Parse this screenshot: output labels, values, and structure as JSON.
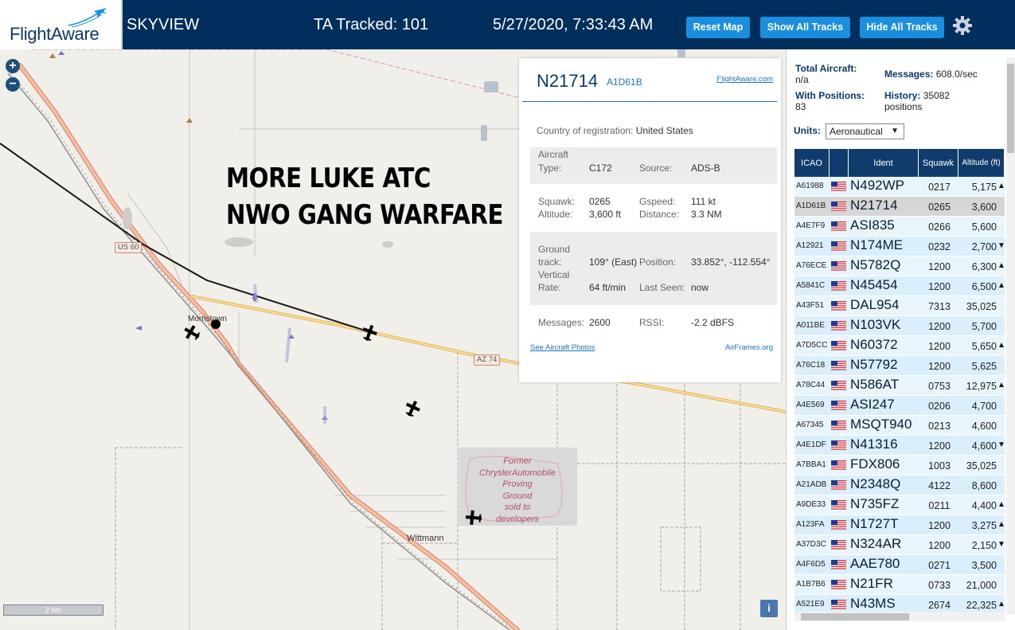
{
  "header": {
    "logo_text": "FlightAware",
    "site_name": "SKYVIEW",
    "tracked": "TA Tracked: 101",
    "datetime": "5/27/2020, 7:33:43 AM",
    "buttons": {
      "reset": "Reset Map",
      "show": "Show All Tracks",
      "hide": "Hide All Tracks"
    },
    "accent": "#1a8fe0",
    "bg": "#002f5d"
  },
  "map": {
    "zoom_in": "+",
    "zoom_out": "−",
    "caption_line1": "MORE LUKE ATC",
    "caption_line2": "NWO GANG WARFARE",
    "place_morristown": "Morristown",
    "place_wittmann": "Wittmann",
    "hwy_us60": "US 60",
    "hwy_az74": "AZ 74",
    "area_label": [
      "Former",
      "ChryslerAutomobile",
      "Proving",
      "Ground",
      "sold to",
      "developers"
    ],
    "scale": "2 nm",
    "info": "i"
  },
  "popup": {
    "ident": "N21714",
    "hex": "A1D61B",
    "link": "FlightAware.com",
    "country_label": "Country of registration:",
    "country": "United States",
    "aircraft_type_label_1": "Aircraft",
    "aircraft_type_label_2": "Type:",
    "aircraft_type": "C172",
    "source_label": "Source:",
    "source": "ADS-B",
    "squawk_label": "Squawk:",
    "squawk": "0265",
    "gspeed_label": "Gspeed:",
    "gspeed": "111 kt",
    "altitude_label": "Altitude:",
    "altitude": "3,600 ft",
    "distance_label": "Distance:",
    "distance": "3.3 NM",
    "track_label_1": "Ground",
    "track_label_2": "track:",
    "track": "109° (East)",
    "position_label": "Position:",
    "position": "33.852°, -112.554°",
    "vrate_label_1": "Vertical",
    "vrate_label_2": "Rate:",
    "vrate": "64 ft/min",
    "lastseen_label": "Last Seen:",
    "lastseen": "now",
    "messages_label": "Messages:",
    "messages": "2600",
    "rssi_label": "RSSI:",
    "rssi": "-2.2 dBFS",
    "photos_link": "See Aircraft Photos",
    "airframes_link": "AirFrames.org"
  },
  "panel": {
    "total_label": "Total Aircraft:",
    "total": "n/a",
    "messages_label": "Messages:",
    "messages": "608.0/sec",
    "positions_label": "With Positions:",
    "positions": "83",
    "history_label": "History:",
    "history": "35082 positions",
    "units_label": "Units:",
    "units_value": "Aeronautical",
    "columns": {
      "icao": "ICAO",
      "ident": "Ident",
      "squawk": "Squawk",
      "altitude": "Altitude (ft)"
    },
    "rows": [
      {
        "icao": "A61988",
        "ident": "N492WP",
        "squawk": "0217",
        "alt": "5,175",
        "trend": "▲"
      },
      {
        "icao": "A1D61B",
        "ident": "N21714",
        "squawk": "0265",
        "alt": "3,600",
        "trend": ""
      },
      {
        "icao": "A4E7F9",
        "ident": "ASI835",
        "squawk": "0266",
        "alt": "5,600",
        "trend": ""
      },
      {
        "icao": "A12921",
        "ident": "N174ME",
        "squawk": "0232",
        "alt": "2,700",
        "trend": "▼"
      },
      {
        "icao": "A76ECE",
        "ident": "N5782Q",
        "squawk": "1200",
        "alt": "6,300",
        "trend": "▲"
      },
      {
        "icao": "A5841C",
        "ident": "N45454",
        "squawk": "1200",
        "alt": "6,500",
        "trend": "▲"
      },
      {
        "icao": "A43F51",
        "ident": "DAL954",
        "squawk": "7313",
        "alt": "35,025",
        "trend": ""
      },
      {
        "icao": "A011BE",
        "ident": "N103VK",
        "squawk": "1200",
        "alt": "5,700",
        "trend": ""
      },
      {
        "icao": "A7D5CC",
        "ident": "N60372",
        "squawk": "1200",
        "alt": "5,650",
        "trend": "▲"
      },
      {
        "icao": "A76C18",
        "ident": "N57792",
        "squawk": "1200",
        "alt": "5,625",
        "trend": ""
      },
      {
        "icao": "A78C44",
        "ident": "N586AT",
        "squawk": "0753",
        "alt": "12,975",
        "trend": "▲"
      },
      {
        "icao": "A4E569",
        "ident": "ASI247",
        "squawk": "0206",
        "alt": "4,700",
        "trend": ""
      },
      {
        "icao": "A67345",
        "ident": "MSQT940",
        "squawk": "0213",
        "alt": "4,600",
        "trend": ""
      },
      {
        "icao": "A4E1DF",
        "ident": "N41316",
        "squawk": "1200",
        "alt": "4,600",
        "trend": "▼"
      },
      {
        "icao": "A7BBA1",
        "ident": "FDX806",
        "squawk": "1003",
        "alt": "35,025",
        "trend": ""
      },
      {
        "icao": "A21ADB",
        "ident": "N2348Q",
        "squawk": "4122",
        "alt": "8,600",
        "trend": ""
      },
      {
        "icao": "A9DE33",
        "ident": "N735FZ",
        "squawk": "0211",
        "alt": "4,400",
        "trend": "▲"
      },
      {
        "icao": "A123FA",
        "ident": "N1727T",
        "squawk": "1200",
        "alt": "3,275",
        "trend": "▲"
      },
      {
        "icao": "A37D3C",
        "ident": "N324AR",
        "squawk": "1200",
        "alt": "2,150",
        "trend": "▼"
      },
      {
        "icao": "A4F6D5",
        "ident": "AAE780",
        "squawk": "0271",
        "alt": "3,500",
        "trend": ""
      },
      {
        "icao": "A1B7B6",
        "ident": "N21FR",
        "squawk": "0733",
        "alt": "21,000",
        "trend": ""
      },
      {
        "icao": "A521E9",
        "ident": "N43MS",
        "squawk": "2674",
        "alt": "22,325",
        "trend": "▲"
      }
    ],
    "selected_icao": "A1D61B"
  }
}
